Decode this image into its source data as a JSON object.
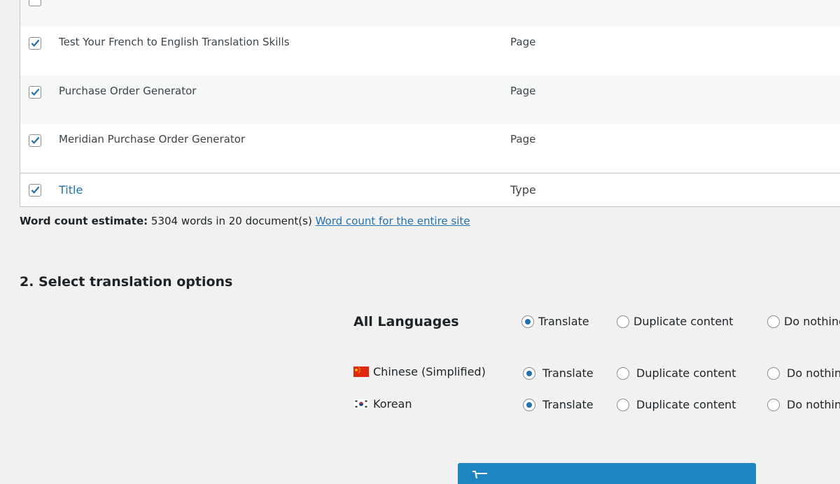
{
  "table": {
    "rows": [
      {
        "title": "Test Your French to English Translation Skills",
        "type": "Page"
      },
      {
        "title": "Purchase Order Generator",
        "type": "Page"
      },
      {
        "title": "Meridian Purchase Order Generator",
        "type": "Page"
      }
    ],
    "footer": {
      "title": "Title",
      "type": "Type"
    }
  },
  "word_count": {
    "label": "Word count estimate:",
    "text": "5304 words in 20 document(s)",
    "link": "Word count for the entire site"
  },
  "section": {
    "title": "2. Select translation options"
  },
  "options": {
    "all_languages": "All Languages",
    "translate": "Translate",
    "duplicate": "Duplicate content",
    "do_nothing": "Do nothing",
    "languages": [
      {
        "name": "Chinese (Simplified)",
        "flag": "china-flag-icon"
      },
      {
        "name": "Korean",
        "flag": "korea-flag-icon"
      }
    ]
  },
  "colors": {
    "accent": "#2271b1",
    "button": "#1d85c2"
  }
}
